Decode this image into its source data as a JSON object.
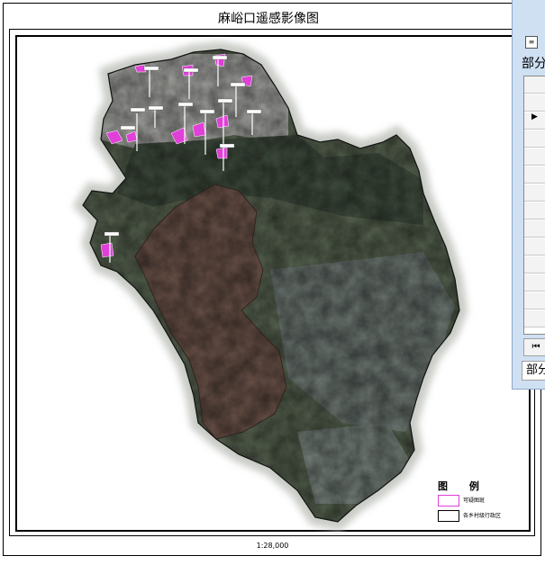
{
  "map": {
    "title": "麻峪口遥感影像图",
    "scale": "1:28,000"
  },
  "legend": {
    "title": "图 例",
    "items": [
      {
        "label": "可疑图斑",
        "color": "#e040d8"
      },
      {
        "label": "各乡村级行政区",
        "color": "#000000"
      }
    ]
  },
  "side_panel": {
    "tab_top": "部分",
    "tab_bottom": "部分",
    "nav_first": "⏮",
    "row_arrow": "▶",
    "menu_icon": "≡"
  },
  "colors": {
    "terrain_green": "#52604c",
    "terrain_light": "#a6a8a2",
    "brown_zone": "#6a5248",
    "highlight": "#e040d8"
  }
}
